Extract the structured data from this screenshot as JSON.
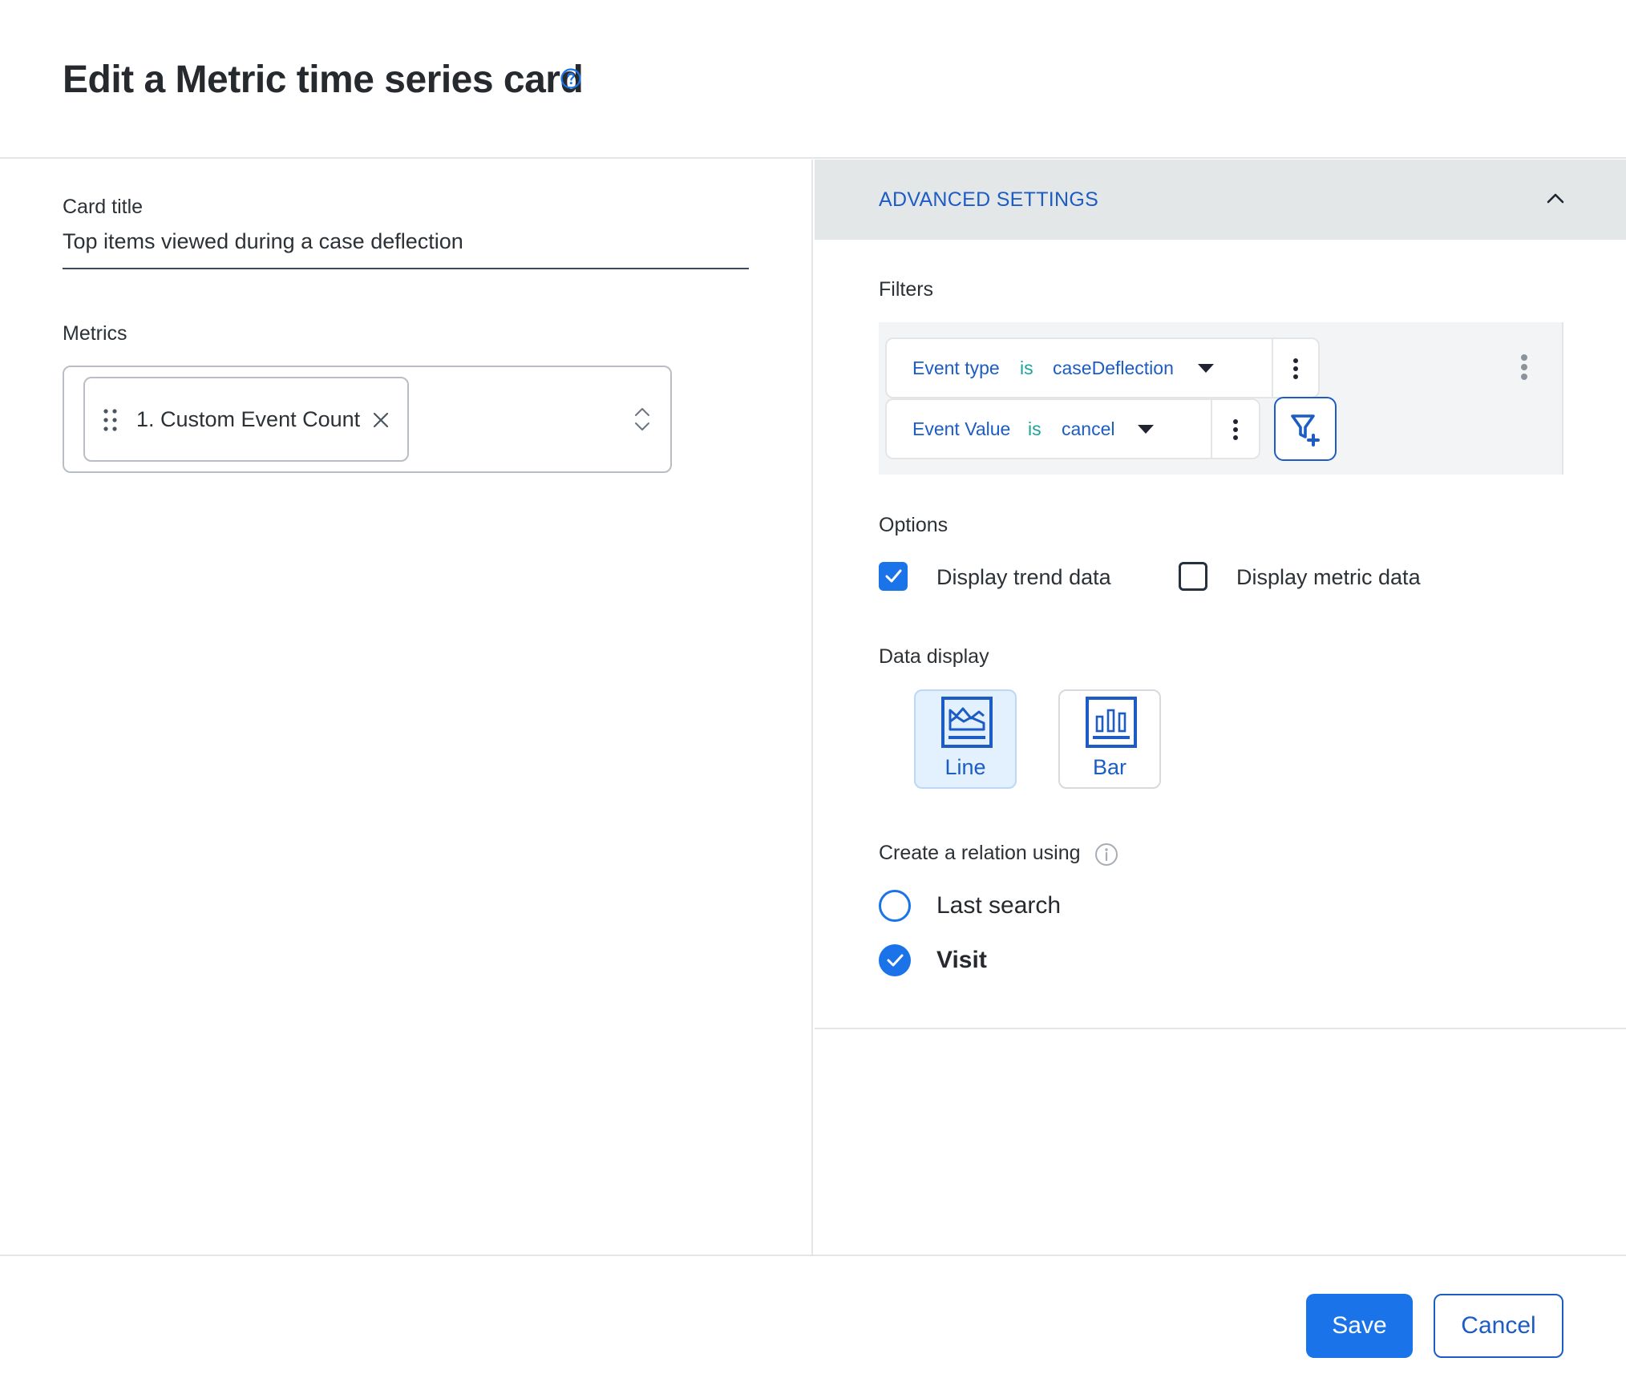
{
  "dialog": {
    "title": "Edit a Metric time series card",
    "help_icon": "help-circle-icon"
  },
  "left": {
    "card_title_label": "Card title",
    "card_title_value": "Top items viewed during a case deflection",
    "metrics_label": "Metrics",
    "metrics": [
      {
        "label": "1. Custom Event Count"
      }
    ]
  },
  "advanced": {
    "title": "ADVANCED SETTINGS",
    "expanded": true,
    "filters_label": "Filters",
    "filters": [
      {
        "field": "Event type",
        "operator": "is",
        "value": "caseDeflection"
      },
      {
        "field": "Event Value",
        "operator": "is",
        "value": "cancel"
      }
    ],
    "options_label": "Options",
    "options": [
      {
        "label": "Display trend data",
        "checked": true
      },
      {
        "label": "Display metric data",
        "checked": false
      }
    ],
    "data_display_label": "Data display",
    "data_display": [
      {
        "label": "Line",
        "selected": true,
        "icon": "line-chart-icon"
      },
      {
        "label": "Bar",
        "selected": false,
        "icon": "bar-chart-icon"
      }
    ],
    "relation_label": "Create a relation using",
    "relations": [
      {
        "label": "Last search",
        "selected": false
      },
      {
        "label": "Visit",
        "selected": true
      }
    ]
  },
  "footer": {
    "save_label": "Save",
    "cancel_label": "Cancel"
  },
  "colors": {
    "accent": "#1a73e8",
    "link": "#1c5cc4",
    "operator": "#1ba39c",
    "section_bg": "#e4e7e8"
  }
}
